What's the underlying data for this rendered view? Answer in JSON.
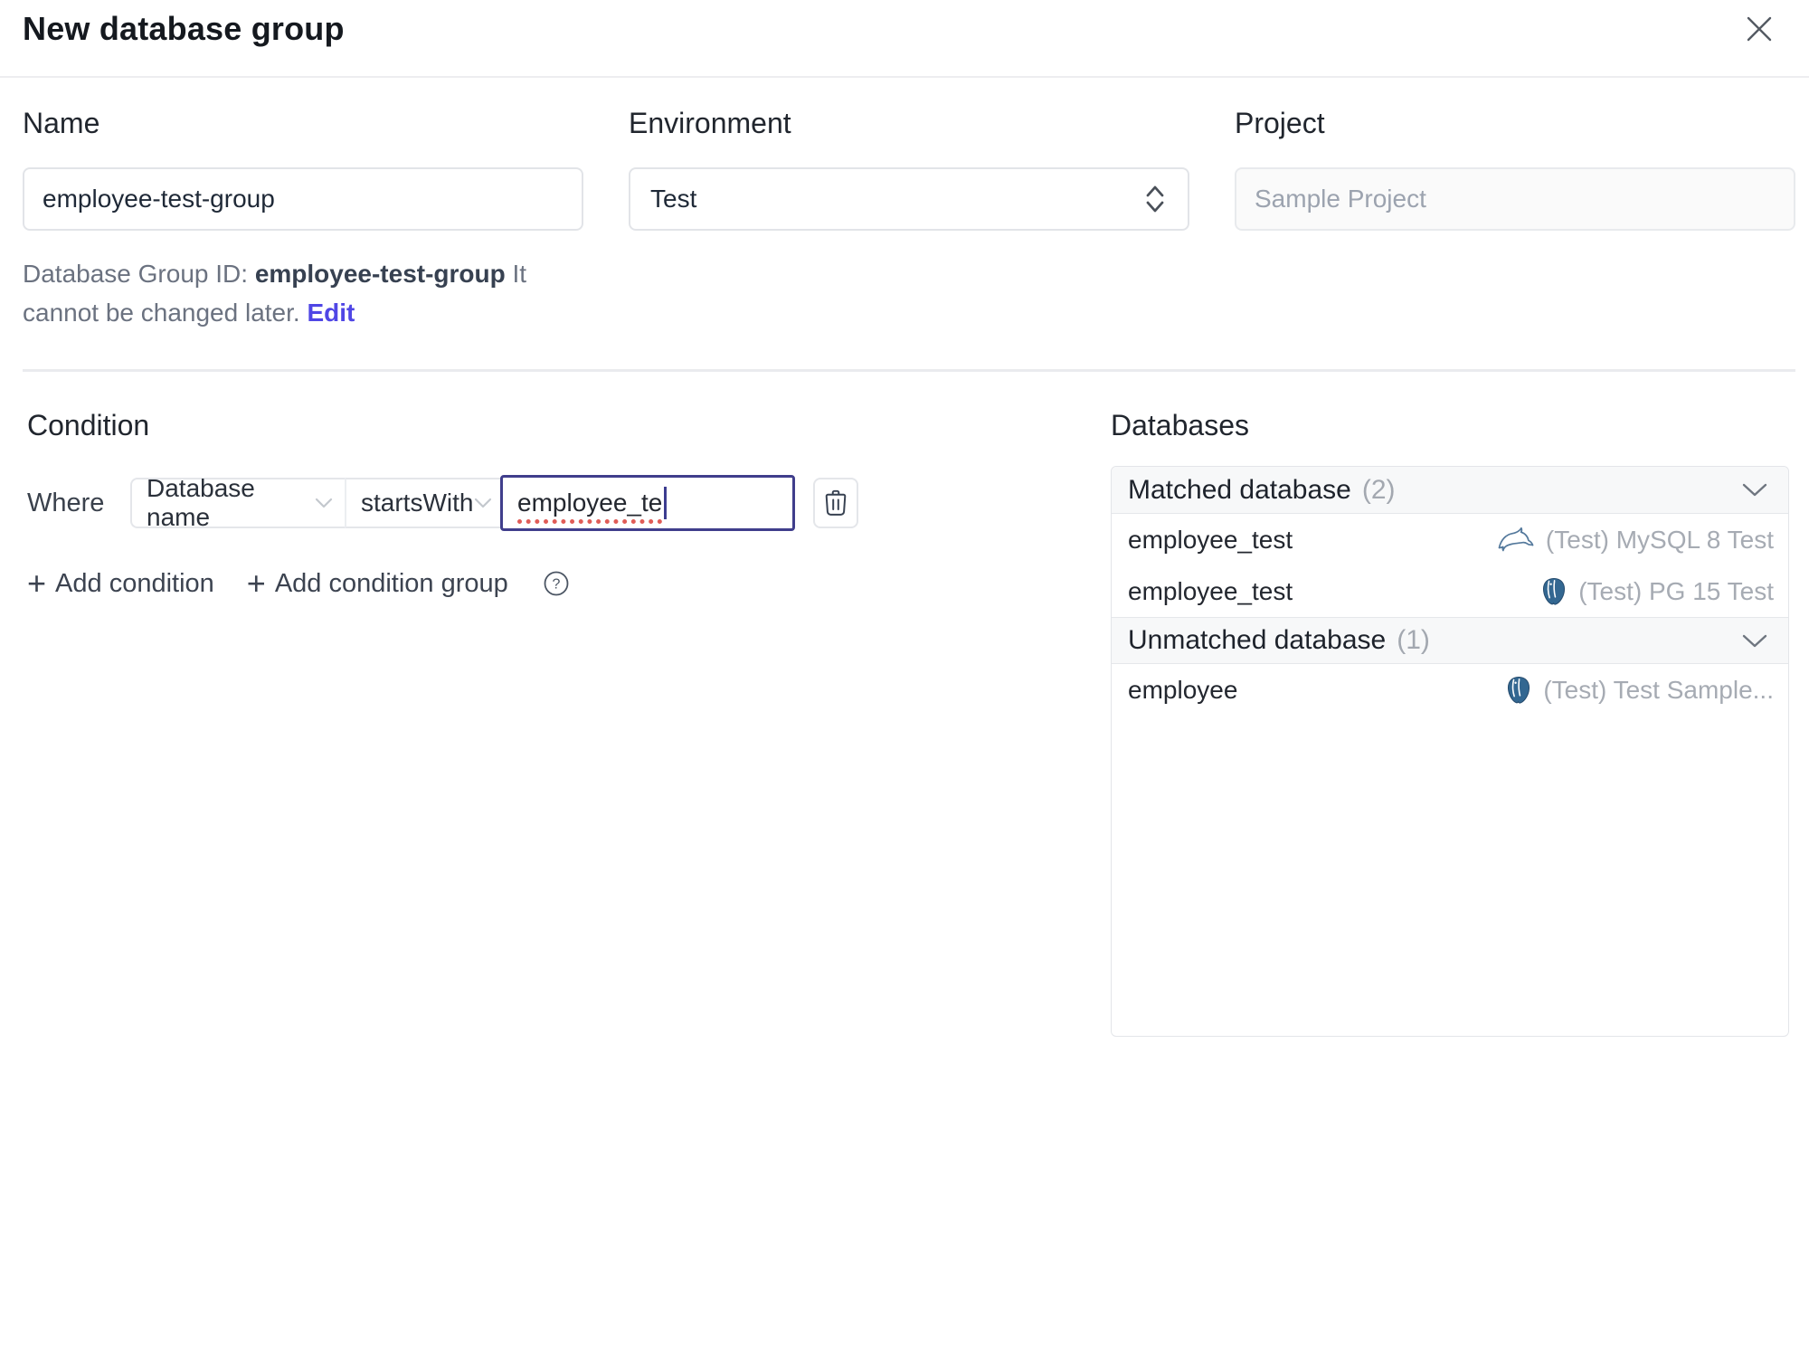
{
  "header": {
    "title": "New database group"
  },
  "form": {
    "name": {
      "label": "Name",
      "value": "employee-test-group"
    },
    "environment": {
      "label": "Environment",
      "value": "Test"
    },
    "project": {
      "label": "Project",
      "value": "Sample Project"
    },
    "id_note": {
      "prefix": "Database Group ID: ",
      "id": "employee-test-group",
      "suffix": " It cannot be changed later. ",
      "edit_label": "Edit"
    }
  },
  "condition": {
    "heading": "Condition",
    "where_label": "Where",
    "factor": "Database name",
    "operator": "startsWith",
    "value": "employee_te",
    "add_condition_label": "Add condition",
    "add_condition_group_label": "Add condition group"
  },
  "databases": {
    "heading": "Databases",
    "matched": {
      "label": "Matched database",
      "count": "(2)",
      "rows": [
        {
          "name": "employee_test",
          "engine": "mysql",
          "instance": "(Test) MySQL 8 Test"
        },
        {
          "name": "employee_test",
          "engine": "postgresql",
          "instance": "(Test) PG 15 Test"
        }
      ]
    },
    "unmatched": {
      "label": "Unmatched database",
      "count": "(1)",
      "rows": [
        {
          "name": "employee",
          "engine": "postgresql",
          "instance": "(Test) Test Sample..."
        }
      ]
    }
  },
  "icons": {
    "close": "close-icon",
    "select_arrows": "updown-chevron-icon",
    "dropdown": "chevron-down-icon",
    "trash": "trash-icon",
    "help": "help-circle-icon",
    "mysql": "mysql-dolphin-icon",
    "postgresql": "postgresql-elephant-icon"
  },
  "colors": {
    "accent": "#4f46e5",
    "focus_border": "#403e8c",
    "spellcheck_underline": "#e05c57",
    "mysql_icon": "#54799c",
    "postgres_icon": "#336791",
    "header_bg": "#f7f8f9",
    "border": "#e3e5e9"
  }
}
